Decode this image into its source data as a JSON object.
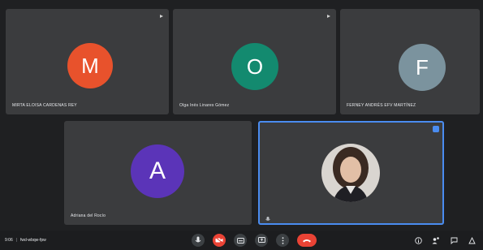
{
  "participants": [
    {
      "initial": "M",
      "name": "MIRTA ELOISA CARDENAS REY",
      "color": "#e8522c"
    },
    {
      "initial": "O",
      "name": "Olga Inés Linares Gómez",
      "color": "#138a6f"
    },
    {
      "initial": "F",
      "name": "FERNEY ANDRÉS EFV MARTÍNEZ",
      "color": "#7b939e"
    },
    {
      "initial": "A",
      "name": "Adriana del Rocío",
      "color": "#5b34b8"
    }
  ],
  "self_tile": {
    "selected": true
  },
  "bottom_bar": {
    "time": "9:06",
    "meeting_code": "fwd-wbqw-fpw"
  },
  "icons": {
    "mic": "mic-icon",
    "camera_off": "camera-off-icon",
    "captions": "captions-icon",
    "present": "present-icon",
    "more": "more-vertical-icon",
    "leave": "call-end-icon",
    "info": "info-icon",
    "people": "people-icon",
    "chat": "chat-icon",
    "activities": "activities-icon"
  }
}
